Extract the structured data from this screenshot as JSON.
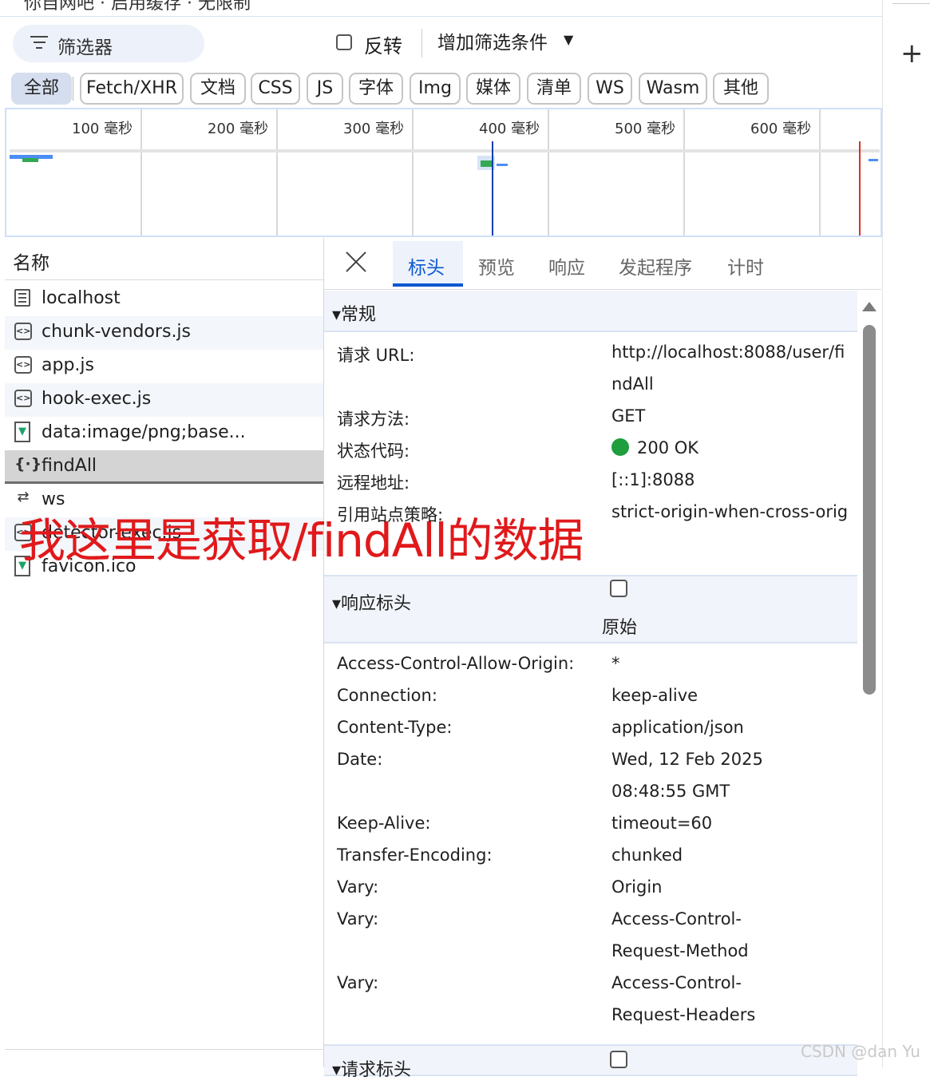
{
  "toolbar": {
    "filter_placeholder": "筛选器",
    "invert_label": "反转",
    "more_filters_label": "增加筛选条件",
    "top_strip_text": "你自网吧 · 启用缓存 · 无限制"
  },
  "type_filters": [
    {
      "label": "全部",
      "active": true
    },
    {
      "label": "Fetch/XHR",
      "active": false
    },
    {
      "label": "文档",
      "active": false
    },
    {
      "label": "CSS",
      "active": false
    },
    {
      "label": "JS",
      "active": false
    },
    {
      "label": "字体",
      "active": false
    },
    {
      "label": "Img",
      "active": false
    },
    {
      "label": "媒体",
      "active": false
    },
    {
      "label": "清单",
      "active": false
    },
    {
      "label": "WS",
      "active": false
    },
    {
      "label": "Wasm",
      "active": false
    },
    {
      "label": "其他",
      "active": false
    }
  ],
  "timeline": {
    "ticks": [
      "100 毫秒",
      "200 毫秒",
      "300 毫秒",
      "400 毫秒",
      "500 毫秒",
      "600 毫秒"
    ],
    "colors": {
      "marker_blue": "#0b3fb3",
      "marker_red": "#d93025",
      "bar_blue": "#4c8df6",
      "bar_green": "#34a853"
    }
  },
  "requests": {
    "header": "名称",
    "rows": [
      {
        "name": "localhost",
        "icon": "document-icon"
      },
      {
        "name": "chunk-vendors.js",
        "icon": "script-icon"
      },
      {
        "name": "app.js",
        "icon": "script-icon"
      },
      {
        "name": "hook-exec.js",
        "icon": "script-icon"
      },
      {
        "name": "data:image/png;base...",
        "icon": "image-icon"
      },
      {
        "name": "findAll",
        "icon": "json-icon",
        "selected": true
      },
      {
        "name": "ws",
        "icon": "websocket-icon"
      },
      {
        "name": "detector-exec.js",
        "icon": "script-icon"
      },
      {
        "name": "favicon.ico",
        "icon": "image-icon"
      }
    ]
  },
  "annotation": "我这里是获取/findAll的数据",
  "details": {
    "tabs": [
      "标头",
      "预览",
      "响应",
      "发起程序",
      "计时"
    ],
    "active_tab": "标头",
    "general": {
      "title": "▾常规",
      "rows": [
        {
          "key": "请求 URL:",
          "value": "http://localhost:8088/user/fi",
          "value2": "ndAll"
        },
        {
          "key": "请求方法:",
          "value": "GET"
        },
        {
          "key": "状态代码:",
          "value": "200 OK"
        },
        {
          "key": "远程地址:",
          "value": "[::1]:8088"
        },
        {
          "key": "引用站点策略:",
          "value": "strict-origin-when-cross-orig"
        }
      ]
    },
    "response_headers": {
      "title": "▾响应标头",
      "raw_label": "原始",
      "rows": [
        {
          "key": "Access-Control-Allow-Origin:",
          "value": "*"
        },
        {
          "key": "Connection:",
          "value": "keep-alive"
        },
        {
          "key": "Content-Type:",
          "value": "application/json"
        },
        {
          "key": "Date:",
          "value": "Wed, 12 Feb 2025",
          "value2": "08:48:55 GMT"
        },
        {
          "key": "Keep-Alive:",
          "value": "timeout=60"
        },
        {
          "key": "Transfer-Encoding:",
          "value": "chunked"
        },
        {
          "key": "Vary:",
          "value": "Origin"
        },
        {
          "key": "Vary:",
          "value": "Access-Control-",
          "value2": "Request-Method"
        },
        {
          "key": "Vary:",
          "value": "Access-Control-",
          "value2": "Request-Headers"
        }
      ]
    },
    "request_headers": {
      "title": "▾请求标头"
    }
  },
  "watermark": "CSDN @dan Yu"
}
